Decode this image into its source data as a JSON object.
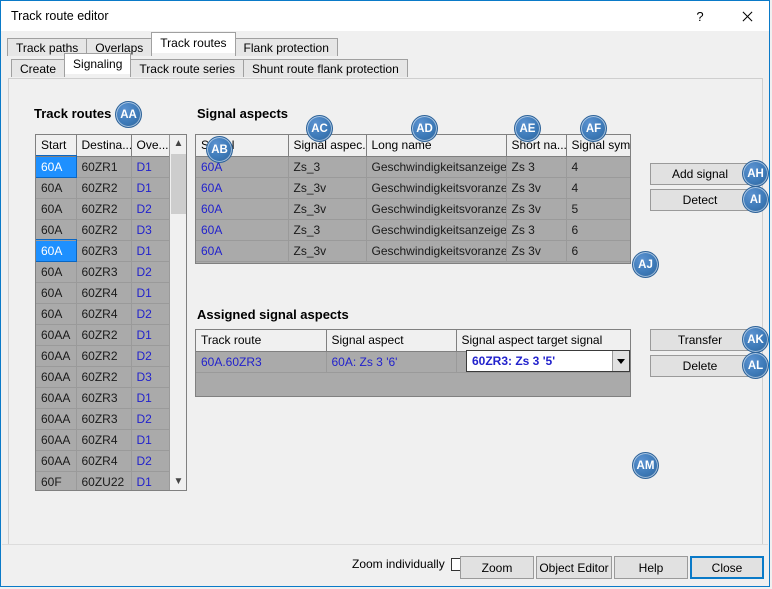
{
  "window": {
    "title": "Track route editor",
    "help_button": "?",
    "close_button": "close-icon"
  },
  "outer_tabs": [
    {
      "label": "Track paths",
      "active": false
    },
    {
      "label": "Overlaps",
      "active": false
    },
    {
      "label": "Track routes",
      "active": true
    },
    {
      "label": "Flank protection",
      "active": false
    }
  ],
  "inner_tabs": [
    {
      "label": "Create",
      "active": false
    },
    {
      "label": "Signaling",
      "active": true
    },
    {
      "label": "Track route series",
      "active": false
    },
    {
      "label": "Shunt route flank protection",
      "active": false
    }
  ],
  "track_routes": {
    "title": "Track routes",
    "badge": "AA",
    "columns": [
      "Start",
      "Destina...",
      "Ove..."
    ],
    "rows": [
      {
        "start": "60A",
        "destination": "60ZR1",
        "overlap": "D1",
        "selected": false
      },
      {
        "start": "60A",
        "destination": "60ZR2",
        "overlap": "D1",
        "selected": false
      },
      {
        "start": "60A",
        "destination": "60ZR2",
        "overlap": "D2",
        "selected": false
      },
      {
        "start": "60A",
        "destination": "60ZR2",
        "overlap": "D3",
        "selected": false
      },
      {
        "start": "60A",
        "destination": "60ZR3",
        "overlap": "D1",
        "selected": true
      },
      {
        "start": "60A",
        "destination": "60ZR3",
        "overlap": "D2",
        "selected": false
      },
      {
        "start": "60A",
        "destination": "60ZR4",
        "overlap": "D1",
        "selected": false
      },
      {
        "start": "60A",
        "destination": "60ZR4",
        "overlap": "D2",
        "selected": false
      },
      {
        "start": "60AA",
        "destination": "60ZR2",
        "overlap": "D1",
        "selected": false
      },
      {
        "start": "60AA",
        "destination": "60ZR2",
        "overlap": "D2",
        "selected": false
      },
      {
        "start": "60AA",
        "destination": "60ZR2",
        "overlap": "D3",
        "selected": false
      },
      {
        "start": "60AA",
        "destination": "60ZR3",
        "overlap": "D1",
        "selected": false
      },
      {
        "start": "60AA",
        "destination": "60ZR3",
        "overlap": "D2",
        "selected": false
      },
      {
        "start": "60AA",
        "destination": "60ZR4",
        "overlap": "D1",
        "selected": false
      },
      {
        "start": "60AA",
        "destination": "60ZR4",
        "overlap": "D2",
        "selected": false
      },
      {
        "start": "60F",
        "destination": "60ZU22",
        "overlap": "D1",
        "selected": false
      }
    ]
  },
  "signal_aspects": {
    "title": "Signal aspects",
    "badges": {
      "signal": "AB",
      "signal_aspect": "AC",
      "long_name": "AD",
      "short_name": "AE",
      "signal_symbol": "AF",
      "grid": "AJ"
    },
    "columns": [
      "Signal",
      "Signal aspec...",
      "Long name",
      "Short na...",
      "Signal sym..."
    ],
    "rows": [
      {
        "signal": "60A",
        "aspect": "Zs_3",
        "long_name": "Geschwindigkeitsanzeiger",
        "short_name": "Zs 3",
        "symbol": "4"
      },
      {
        "signal": "60A",
        "aspect": "Zs_3v",
        "long_name": "Geschwindigkeitsvoranzei...",
        "short_name": "Zs 3v",
        "symbol": "4"
      },
      {
        "signal": "60A",
        "aspect": "Zs_3v",
        "long_name": "Geschwindigkeitsvoranzei...",
        "short_name": "Zs 3v",
        "symbol": "5"
      },
      {
        "signal": "60A",
        "aspect": "Zs_3",
        "long_name": "Geschwindigkeitsanzeiger",
        "short_name": "Zs 3",
        "symbol": "6"
      },
      {
        "signal": "60A",
        "aspect": "Zs_3v",
        "long_name": "Geschwindigkeitsvoranzei...",
        "short_name": "Zs 3v",
        "symbol": "6"
      }
    ]
  },
  "assigned_signal_aspects": {
    "title": "Assigned signal aspects",
    "badge": "AM",
    "columns": [
      "Track route",
      "Signal aspect",
      "Signal aspect target signal"
    ],
    "rows": [
      {
        "track_route": "60A.60ZR3",
        "signal_aspect": "60A: Zs 3 '6'",
        "target_signal": "60ZR3: Zs 3 '5'"
      }
    ]
  },
  "side_buttons": [
    {
      "label": "Add signal",
      "badge": "AH"
    },
    {
      "label": "Detect",
      "badge": "AI"
    },
    {
      "label": "Transfer",
      "badge": "AK"
    },
    {
      "label": "Delete",
      "badge": "AL"
    }
  ],
  "footer": {
    "zoom_individually_label": "Zoom individually",
    "zoom_individually_checked": false,
    "buttons": [
      {
        "label": "Zoom",
        "default": false
      },
      {
        "label": "Object Editor",
        "default": false
      },
      {
        "label": "Help",
        "default": false
      },
      {
        "label": "Close",
        "default": true
      }
    ]
  }
}
